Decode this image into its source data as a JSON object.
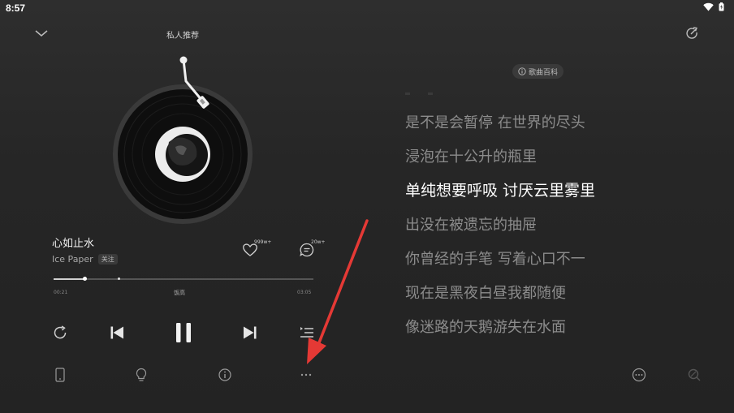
{
  "status_bar": {
    "time": "8:57"
  },
  "header": {
    "title": "私人推荐"
  },
  "song": {
    "title": "心如止水",
    "artist": "Ice Paper",
    "follow_label": "关注",
    "like_count": "999w+",
    "comment_count": "20w+"
  },
  "progress": {
    "elapsed": "00:21",
    "total": "03:05",
    "played_fraction": 0.12,
    "chorus_fraction": 0.25,
    "chorus_label": "饭高"
  },
  "lyrics": {
    "baike_label": "歌曲百科",
    "lines": [
      {
        "text": "是不是会暂停 在世界的尽头"
      },
      {
        "text": "浸泡在十公升的瓶里"
      },
      {
        "text": "单纯想要呼吸 讨厌云里雾里"
      },
      {
        "text": "出没在被遗忘的抽屉"
      },
      {
        "text": "你曾经的手笔 写着心口不一"
      },
      {
        "text": "现在是黑夜白昼我都随便"
      },
      {
        "text": "像迷路的天鹅游失在水面"
      }
    ],
    "active_index": 2
  },
  "colors": {
    "background": "#262626",
    "active_lyric": "#ffffff",
    "inactive_lyric": "#8c8c8c",
    "annotation_arrow": "#e53935"
  },
  "icons": {
    "collapse": "chevron-down-icon",
    "share": "share-icon",
    "like": "heart-icon",
    "comment": "comment-icon",
    "repeat": "repeat-icon",
    "previous": "skip-previous-icon",
    "pause": "pause-icon",
    "next": "skip-next-icon",
    "playlist": "playlist-icon",
    "device": "phone-icon",
    "tip": "lightbulb-icon",
    "info": "info-icon",
    "more": "more-horizontal-icon",
    "lyric_more": "more-circle-icon",
    "lyric_search": "search-icon"
  }
}
